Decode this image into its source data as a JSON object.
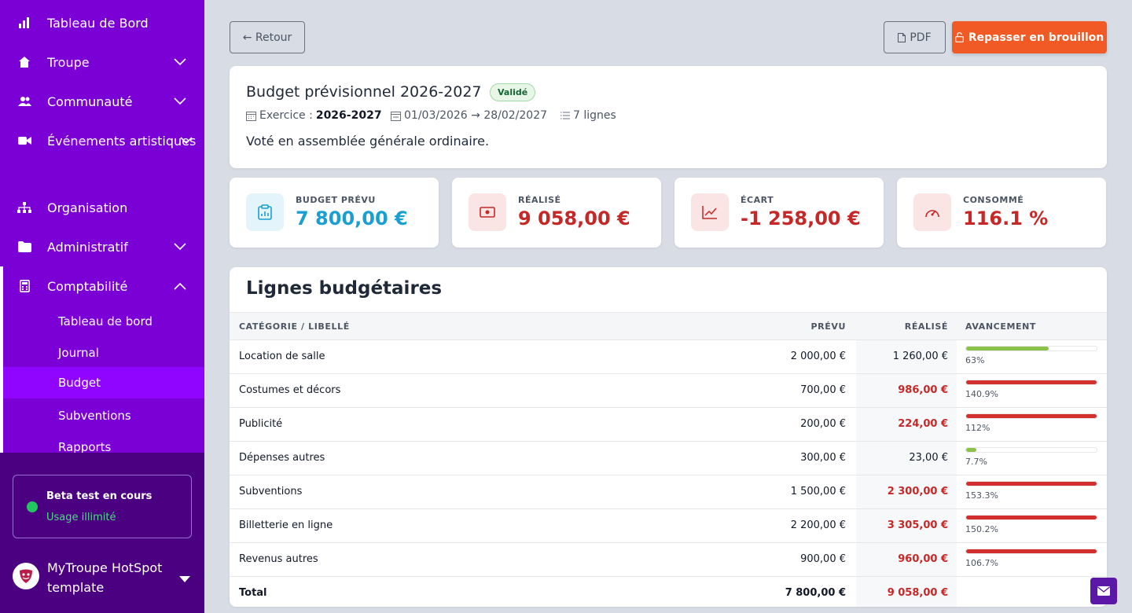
{
  "sidebar": {
    "items": [
      {
        "label": "Tableau de Bord",
        "icon": "bar-chart-icon"
      },
      {
        "label": "Troupe",
        "icon": "home-icon"
      },
      {
        "label": "Communauté",
        "icon": "users-icon"
      },
      {
        "label": "Événements artistiques",
        "icon": "video-icon"
      },
      {
        "label": "Organisation",
        "icon": "sitemap-icon"
      },
      {
        "label": "Administratif",
        "icon": "folder-icon"
      },
      {
        "label": "Comptabilité",
        "icon": "calculator-icon"
      }
    ],
    "sub_items": [
      "Tableau de bord",
      "Journal",
      "Budget",
      "Subventions",
      "Rapports"
    ],
    "beta_title": "Beta test en cours",
    "beta_sub": "Usage illimité",
    "org_name": "MyTroupe HotSpot template"
  },
  "toolbar": {
    "back_label": "← Retour",
    "pdf_label": "PDF",
    "draft_label": "Repasser en brouillon"
  },
  "budget": {
    "title": "Budget prévisionnel 2026-2027",
    "status": "Validé",
    "exercice_label": "Exercice :",
    "exercice_value": "2026-2027",
    "period": "01/03/2026 → 28/02/2027",
    "lines_count": "7 lignes",
    "description": "Voté en assemblée générale ordinaire."
  },
  "stats": [
    {
      "label": "BUDGET PRÉVU",
      "value": "7 800,00 €",
      "color": "#1a9fd1",
      "icon": "clipboard-icon"
    },
    {
      "label": "RÉALISÉ",
      "value": "9 058,00 €",
      "color": "#c62828",
      "icon": "banknote-icon"
    },
    {
      "label": "ÉCART",
      "value": "-1 258,00 €",
      "color": "#c62828",
      "icon": "trend-icon"
    },
    {
      "label": "CONSOMMÉ",
      "value": "116.1 %",
      "color": "#c62828",
      "icon": "gauge-icon"
    }
  ],
  "table": {
    "title": "Lignes budgétaires",
    "headers": {
      "category": "CATÉGORIE / LIBELLÉ",
      "prevu": "PRÉVU",
      "realise": "RÉALISÉ",
      "progress": "AVANCEMENT"
    },
    "rows": [
      {
        "label": "Location de salle",
        "prevu": "2 000,00 €",
        "realise": "1 260,00 €",
        "over": false,
        "pct": "63%",
        "fill": 0.63
      },
      {
        "label": "Costumes et décors",
        "prevu": "700,00 €",
        "realise": "986,00 €",
        "over": true,
        "pct": "140.9%",
        "fill": 1
      },
      {
        "label": "Publicité",
        "prevu": "200,00 €",
        "realise": "224,00 €",
        "over": true,
        "pct": "112%",
        "fill": 1
      },
      {
        "label": "Dépenses autres",
        "prevu": "300,00 €",
        "realise": "23,00 €",
        "over": false,
        "pct": "7.7%",
        "fill": 0.077
      },
      {
        "label": "Subventions",
        "prevu": "1 500,00 €",
        "realise": "2 300,00 €",
        "over": true,
        "pct": "153.3%",
        "fill": 1
      },
      {
        "label": "Billetterie en ligne",
        "prevu": "2 200,00 €",
        "realise": "3 305,00 €",
        "over": true,
        "pct": "150.2%",
        "fill": 1
      },
      {
        "label": "Revenus autres",
        "prevu": "900,00 €",
        "realise": "960,00 €",
        "over": true,
        "pct": "106.7%",
        "fill": 1
      }
    ],
    "total": {
      "label": "Total",
      "prevu": "7 800,00 €",
      "realise": "9 058,00 €"
    }
  },
  "colors": {
    "over": "#d32f2f",
    "ok": "#8bc34a",
    "accent": "#f15a24",
    "sidebar": "#7b00d6"
  }
}
